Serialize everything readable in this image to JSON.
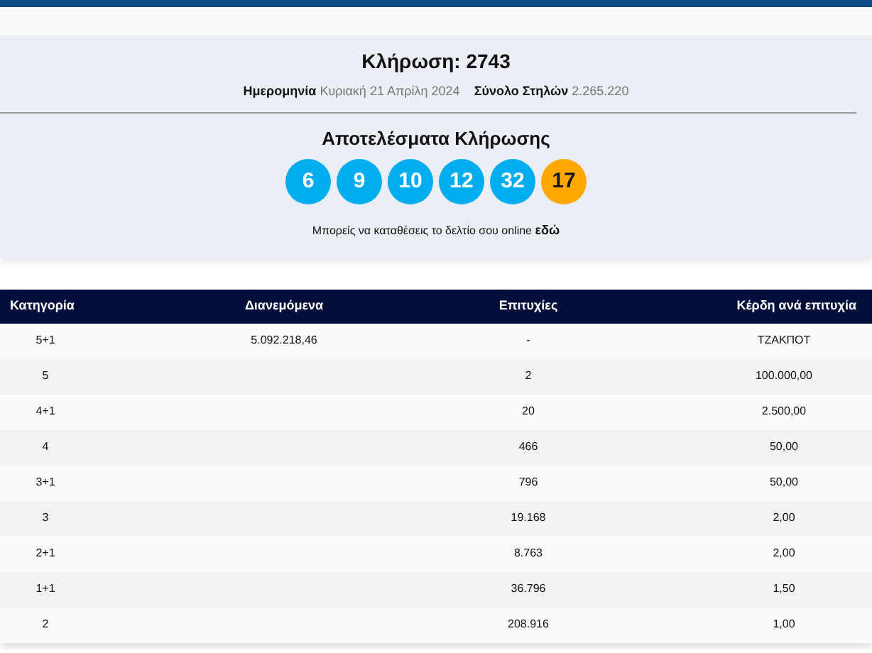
{
  "draw": {
    "title": "Κλήρωση: 2743",
    "date_label": "Ημερομηνία",
    "date_value": "Κυριακή 21 Απρίλη 2024",
    "columns_label": "Σύνολο Στηλών",
    "columns_value": "2.265.220"
  },
  "results": {
    "heading": "Αποτελέσματα Κλήρωσης",
    "balls": [
      {
        "number": "6",
        "kind": "main"
      },
      {
        "number": "9",
        "kind": "main"
      },
      {
        "number": "10",
        "kind": "main"
      },
      {
        "number": "12",
        "kind": "main"
      },
      {
        "number": "32",
        "kind": "main"
      },
      {
        "number": "17",
        "kind": "bonus"
      }
    ],
    "note": "Μπορείς να καταθέσεις το δελτίο σου online",
    "link": "εδώ"
  },
  "table": {
    "columns": [
      "Κατηγορία",
      "Διανεμόμενα",
      "Επιτυχίες",
      "Κέρδη ανά επιτυχία"
    ],
    "rows": [
      [
        "5+1",
        "5.092.218,46",
        "-",
        "ΤΖΑΚΠΟΤ"
      ],
      [
        "5",
        "",
        "2",
        "100.000,00"
      ],
      [
        "4+1",
        "",
        "20",
        "2.500,00"
      ],
      [
        "4",
        "",
        "466",
        "50,00"
      ],
      [
        "3+1",
        "",
        "796",
        "50,00"
      ],
      [
        "3",
        "",
        "19.168",
        "2,00"
      ],
      [
        "2+1",
        "",
        "8.763",
        "2,00"
      ],
      [
        "1+1",
        "",
        "36.796",
        "1,50"
      ],
      [
        "2",
        "",
        "208.916",
        "1,00"
      ]
    ]
  }
}
